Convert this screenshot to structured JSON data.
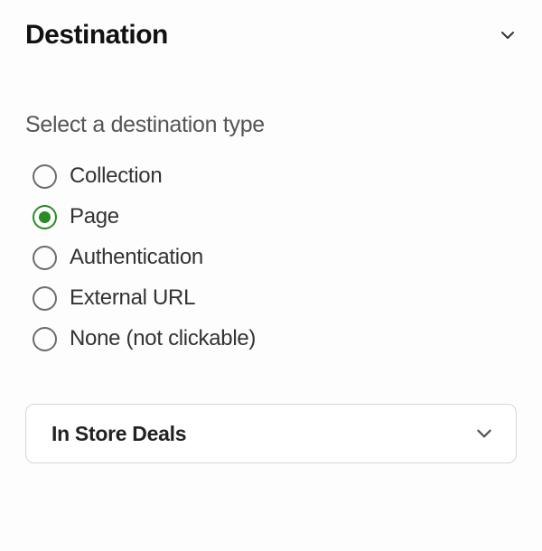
{
  "section": {
    "title": "Destination"
  },
  "prompt": "Select a destination type",
  "radios": {
    "items": [
      {
        "label": "Collection"
      },
      {
        "label": "Page"
      },
      {
        "label": "Authentication"
      },
      {
        "label": "External URL"
      },
      {
        "label": "None (not clickable)"
      }
    ],
    "selected_index": 1
  },
  "select": {
    "value": "In Store Deals"
  },
  "colors": {
    "accent": "#2a8a26",
    "radio_border": "#6c6c6c"
  }
}
